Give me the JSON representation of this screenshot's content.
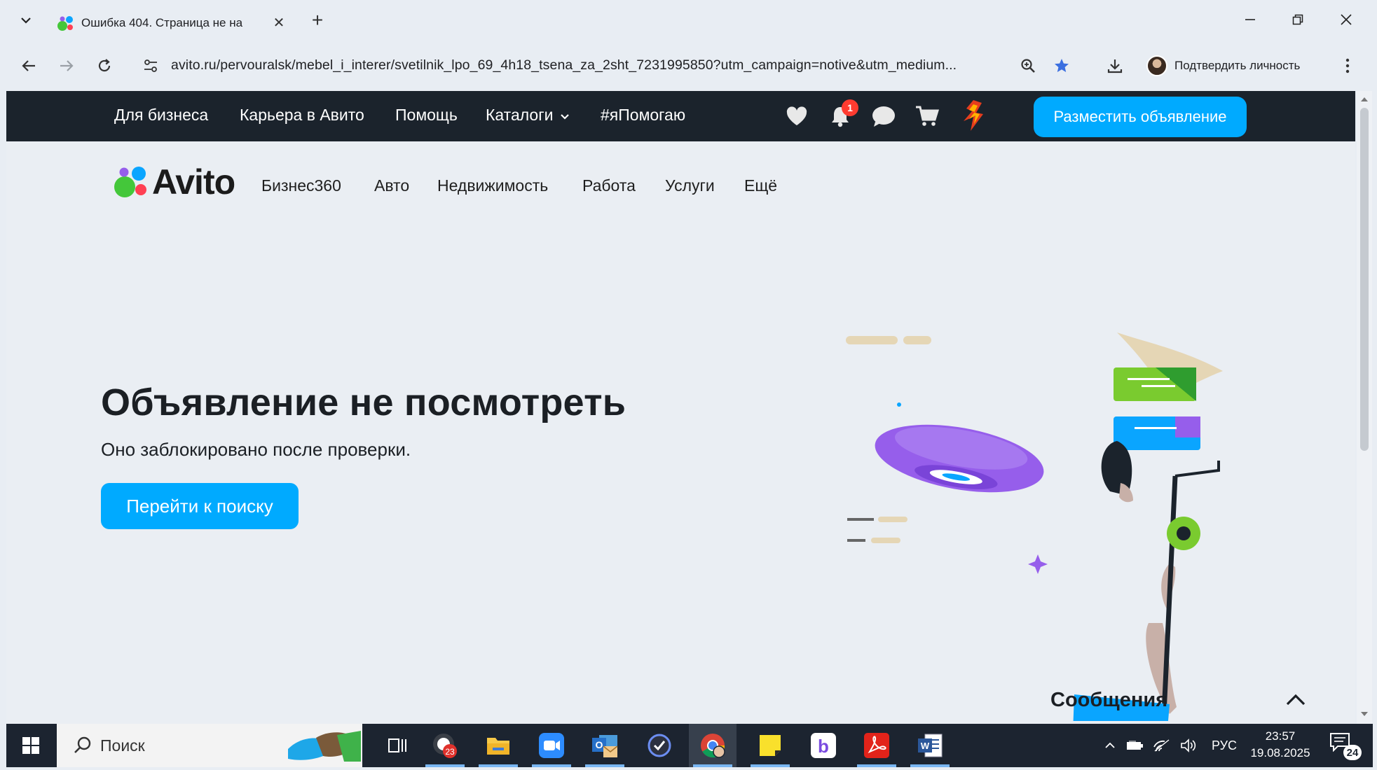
{
  "browser": {
    "tab": {
      "title": "Ошибка 404. Страница не на",
      "close_symbol": "✕"
    },
    "new_tab_symbol": "+",
    "url": "avito.ru/pervouralsk/mebel_i_interer/svetilnik_lpo_69_4h18_tsena_za_2sht_7231995850?utm_campaign=notive&utm_medium...",
    "profile_label": "Подтвердить личность"
  },
  "avito": {
    "topnav": {
      "links": [
        "Для бизнеса",
        "Карьера в Авито",
        "Помощь",
        "Каталоги",
        "#яПомогаю"
      ],
      "notifications_count": "1",
      "post_button": "Разместить объявление"
    },
    "logo_text": "Avito",
    "category_nav": [
      "Бизнес360",
      "Авто",
      "Недвижимость",
      "Работа",
      "Услуги",
      "Ещё"
    ],
    "error": {
      "headline": "Объявление не посмотреть",
      "subline": "Оно заблокировано после проверки.",
      "button": "Перейти к поиску"
    },
    "messages_panel": {
      "title": "Сообщения"
    },
    "colors": {
      "accent": "#00aaff",
      "dark_nav": "#1b232c",
      "badge": "#ff3b30",
      "logo_green": "#44c73a",
      "logo_blue": "#0aa5ff",
      "logo_red": "#ff4053"
    }
  },
  "taskbar": {
    "search_placeholder": "Поиск",
    "lang": "РУС",
    "time": "23:57",
    "date": "19.08.2025",
    "app_badge": "23",
    "notification_count": "24"
  }
}
